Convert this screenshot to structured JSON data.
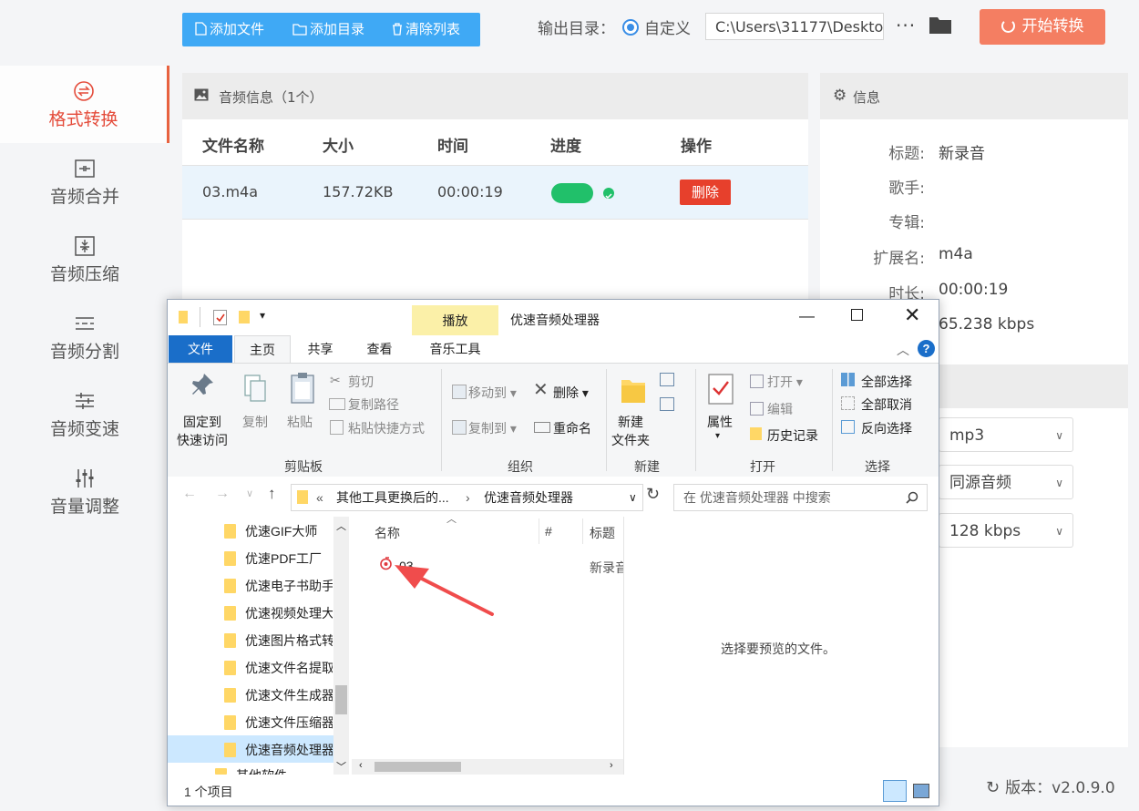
{
  "sidebar": {
    "items": [
      {
        "label": "格式转换",
        "icon": "format-convert-icon"
      },
      {
        "label": "音频合并",
        "icon": "audio-merge-icon"
      },
      {
        "label": "音频压缩",
        "icon": "audio-compress-icon"
      },
      {
        "label": "音频分割",
        "icon": "audio-split-icon"
      },
      {
        "label": "音频变速",
        "icon": "audio-speed-icon"
      },
      {
        "label": "音量调整",
        "icon": "volume-adjust-icon"
      }
    ]
  },
  "toolbar": {
    "add_file": "添加文件",
    "add_dir": "添加目录",
    "clear_list": "清除列表",
    "output_label": "输出目录：",
    "custom_label": "自定义",
    "path": "C:\\Users\\31177\\Deskto",
    "more": "···",
    "start": "开始转换"
  },
  "audio_panel": {
    "title": "音频信息（1个）",
    "columns": [
      "文件名称",
      "大小",
      "时间",
      "进度",
      "操作"
    ],
    "rows": [
      {
        "name": "03.m4a",
        "size": "157.72KB",
        "time": "00:00:19",
        "progress": 1.0,
        "action": "删除"
      }
    ]
  },
  "info_panel": {
    "title": "信息",
    "fields": [
      {
        "key": "标题:",
        "value": "新录音"
      },
      {
        "key": "歌手:",
        "value": ""
      },
      {
        "key": "专辑:",
        "value": ""
      },
      {
        "key": "扩展名:",
        "value": "m4a"
      },
      {
        "key": "时长:",
        "value": "00:00:19"
      },
      {
        "key": "",
        "value": "65.238 kbps"
      }
    ],
    "selects": [
      "mp3",
      "同源音频",
      "128 kbps"
    ]
  },
  "version": "版本：v2.0.9.0",
  "explorer": {
    "title": "优速音频处理器",
    "play_tab": "播放",
    "music_tools": "音乐工具",
    "tabs": [
      "文件",
      "主页",
      "共享",
      "查看"
    ],
    "ribbon": {
      "pin": "固定到\n快速访问",
      "pin_l1": "固定到",
      "pin_l2": "快速访问",
      "copy": "复制",
      "paste": "粘贴",
      "cut": "剪切",
      "copy_path": "复制路径",
      "paste_shortcut": "粘贴快捷方式",
      "clipboard": "剪贴板",
      "move_to": "移动到",
      "copy_to": "复制到",
      "delete": "删除",
      "rename": "重命名",
      "organize": "组织",
      "new_folder_l1": "新建",
      "new_folder_l2": "文件夹",
      "new": "新建",
      "properties": "属性",
      "open": "打开",
      "edit": "编辑",
      "history": "历史记录",
      "open_group": "打开",
      "select_all": "全部选择",
      "select_none": "全部取消",
      "invert": "反向选择",
      "select_group": "选择"
    },
    "address": {
      "prefix": "«",
      "part1": "其他工具更换后的...",
      "sep": "›",
      "part2": "优速音频处理器"
    },
    "search_placeholder": "在 优速音频处理器 中搜索",
    "nav_items": [
      "优速GIF大师",
      "优速PDF工厂",
      "优速电子书助手",
      "优速视频处理大师",
      "优速图片格式转换器",
      "优速文件名提取器",
      "优速文件生成器",
      "优速文件压缩器",
      "优速音频处理器",
      "其他软件"
    ],
    "file_columns": [
      "名称",
      "#",
      "标题"
    ],
    "files": [
      {
        "name": "03",
        "title": "新录音"
      }
    ],
    "preview_text": "选择要预览的文件。",
    "status": "1 个项目"
  },
  "colors": {
    "accent": "#e8623f",
    "blue": "#3fa9f5",
    "green": "#21c06a",
    "red": "#e7402c"
  }
}
